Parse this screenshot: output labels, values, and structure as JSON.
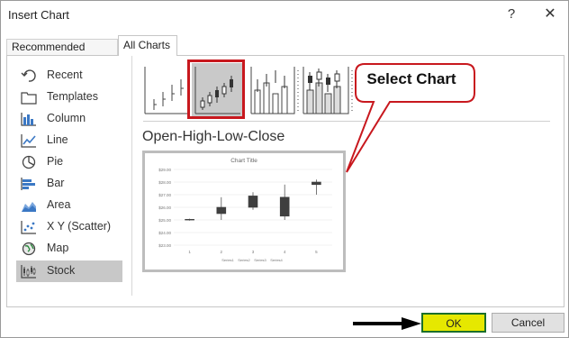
{
  "dialog": {
    "title": "Insert Chart",
    "help_glyph": "?",
    "close_glyph": "✕"
  },
  "tabs": [
    {
      "label": "Recommended Charts",
      "active": false
    },
    {
      "label": "All Charts",
      "active": true
    }
  ],
  "sidebar": {
    "items": [
      {
        "label": "Recent",
        "icon": "recent-icon"
      },
      {
        "label": "Templates",
        "icon": "templates-icon"
      },
      {
        "label": "Column",
        "icon": "column-chart-icon"
      },
      {
        "label": "Line",
        "icon": "line-chart-icon"
      },
      {
        "label": "Pie",
        "icon": "pie-chart-icon"
      },
      {
        "label": "Bar",
        "icon": "bar-chart-icon"
      },
      {
        "label": "Area",
        "icon": "area-chart-icon"
      },
      {
        "label": "X Y (Scatter)",
        "icon": "scatter-chart-icon"
      },
      {
        "label": "Map",
        "icon": "map-chart-icon"
      },
      {
        "label": "Stock",
        "icon": "stock-chart-icon",
        "selected": true
      }
    ]
  },
  "subtypes": [
    {
      "icon": "high-low-close-icon",
      "selected": false
    },
    {
      "icon": "open-high-low-close-icon",
      "selected": true
    },
    {
      "icon": "volume-high-low-close-icon",
      "selected": false
    },
    {
      "icon": "volume-open-high-low-close-icon",
      "selected": false
    }
  ],
  "subtype_title": "Open-High-Low-Close",
  "callout": {
    "text": "Select Chart"
  },
  "buttons": {
    "ok": "OK",
    "cancel": "Cancel"
  },
  "colors": {
    "accent_frame": "#c8181e",
    "ok_fill": "#e6e800",
    "ok_border": "#1b6f2a",
    "selected_bg": "#c8c8c8"
  },
  "preview_chart": {
    "title": "Chart Title",
    "y_ticks": [
      "$29.00",
      "$28.00",
      "$27.00",
      "$26.00",
      "$25.00",
      "$24.00",
      "$23.00"
    ],
    "x_ticks": [
      "1",
      "2",
      "3",
      "4",
      "5"
    ],
    "legend": [
      "Series1",
      "Series2",
      "Series3",
      "Series4"
    ]
  },
  "chart_data": {
    "type": "candlestick",
    "title": "Chart Title",
    "categories": [
      "1",
      "2",
      "3",
      "4",
      "5"
    ],
    "ylim": [
      23,
      29
    ],
    "candles": [
      {
        "open": 25.0,
        "high": 25.1,
        "low": 24.95,
        "close": 25.05
      },
      {
        "open": 25.5,
        "high": 26.8,
        "low": 25.0,
        "close": 26.0
      },
      {
        "open": 26.0,
        "high": 27.2,
        "low": 25.8,
        "close": 26.9
      },
      {
        "open": 25.3,
        "high": 27.8,
        "low": 25.0,
        "close": 26.8
      },
      {
        "open": 27.8,
        "high": 28.2,
        "low": 27.0,
        "close": 28.0
      }
    ],
    "legend": [
      "Series1",
      "Series2",
      "Series3",
      "Series4"
    ],
    "grid": true
  }
}
